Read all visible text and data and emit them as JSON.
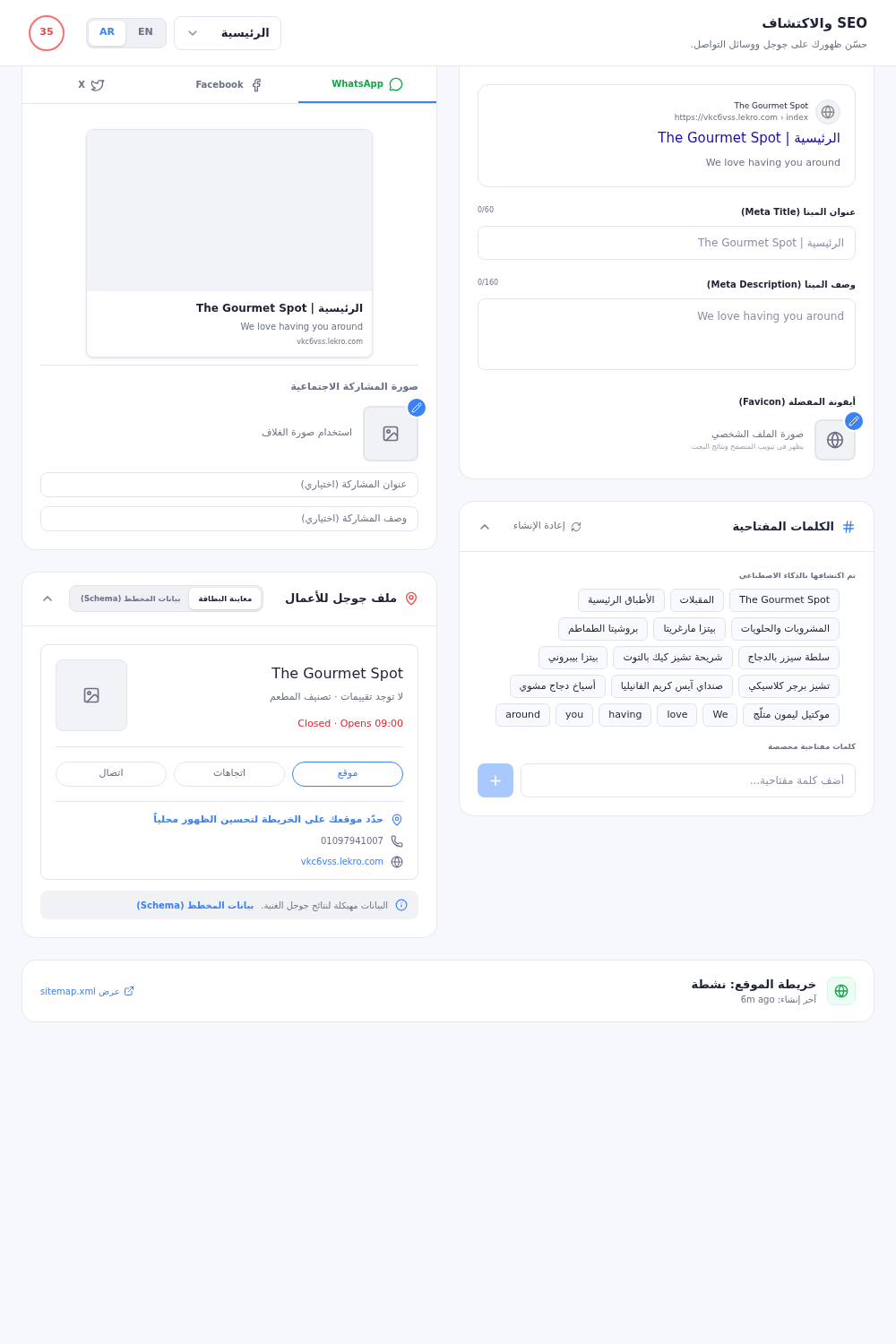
{
  "header": {
    "title": "SEO والاكتشاف",
    "subtitle": "حسّن ظهورك على جوجل ووسائل التواصل.",
    "page_select": "الرئيسية",
    "languages": [
      {
        "label": "EN",
        "selected": false
      },
      {
        "label": "AR",
        "selected": true
      }
    ],
    "score": "35"
  },
  "seo": {
    "preview": {
      "site": "The Gourmet Spot",
      "url": "https://vkc6vss.lekro.com › index",
      "title": "الرئيسية | The Gourmet Spot",
      "description": "We love having you around"
    },
    "meta_title": {
      "label": "عنوان الميتا (Meta Title)",
      "count": "0/60",
      "placeholder": "الرئيسية | The Gourmet Spot"
    },
    "meta_description": {
      "label": "وصف الميتا (Meta Description)",
      "count": "0/160",
      "placeholder": "We love having you around"
    },
    "favicon": {
      "label": "أيقونة المفضلة (Favicon)",
      "title": "صورة الملف الشخصي",
      "hint": "يظهر في تبويب المتصفح ونتائج البحث"
    }
  },
  "keywords": {
    "title": "الكلمات المفتاحية",
    "regenerate": "إعادة الإنشاء",
    "expanded": true,
    "ai_label": "تم اكتشافها بالذكاء الاصطناعي",
    "ai_keywords": [
      "The Gourmet Spot",
      "المقبلات",
      "الأطباق الرئيسية",
      "المشروبات والحلويات",
      "بيتزا مارغريتا",
      "بروشيتا الطماطم",
      "سلطة سيزر بالدجاج",
      "شريحة تشيز كيك بالتوت",
      "بيتزا بيبروني",
      "تشيز برجر كلاسيكي",
      "صنداي آيس كريم الفانيليا",
      "أسياخ دجاج مشوي",
      "موكتيل ليمون متلّج",
      "We",
      "love",
      "having",
      "you",
      "around"
    ],
    "custom_label": "كلمات مفتاحية مخصصة",
    "placeholder": "أضف كلمة مفتاحية...",
    "add": "+"
  },
  "social": {
    "tabs": [
      {
        "label": "WhatsApp",
        "selected": true
      },
      {
        "label": "Facebook",
        "selected": false
      },
      {
        "label": "X",
        "selected": false
      }
    ],
    "preview": {
      "title": "الرئيسية | The Gourmet Spot",
      "description": "We love having you around",
      "domain": "vkc6vss.lekro.com"
    },
    "image_label": "صورة المشاركة الاجتماعية",
    "image_hint": "استخدام صورة الغلاف",
    "title_placeholder": "عنوان المشاركة (اختياري)",
    "description_placeholder": "وصف المشاركة (اختياري)"
  },
  "business": {
    "title": "ملف جوجل للأعمال",
    "expanded": true,
    "tabs": [
      {
        "label": "معاينة البطاقة",
        "selected": true
      },
      {
        "label": "بيانات المخطط (Schema)",
        "selected": false
      }
    ],
    "name": "The Gourmet Spot",
    "meta": "لا توجد تقييمات · تصنيف المطعم",
    "hours": "Closed · Opens 09:00",
    "actions": [
      {
        "label": "موقع",
        "selected": true
      },
      {
        "label": "اتجاهات",
        "selected": false
      },
      {
        "label": "اتصال",
        "selected": false
      }
    ],
    "map_link": "حدّد موقعك على الخريطة لتحسين الظهور محلياً",
    "phone": "01097941007",
    "website": "vkc6vss.lekro.com",
    "info": "البيانات مهيكلة لنتائج جوجل الغنية.",
    "info_link": "بيانات المخطط (Schema)"
  },
  "sitemap": {
    "title": "خريطة الموقع: نشطة",
    "subtitle": "آخر إنشاء: 6m ago",
    "link": "عرض sitemap.xml"
  }
}
